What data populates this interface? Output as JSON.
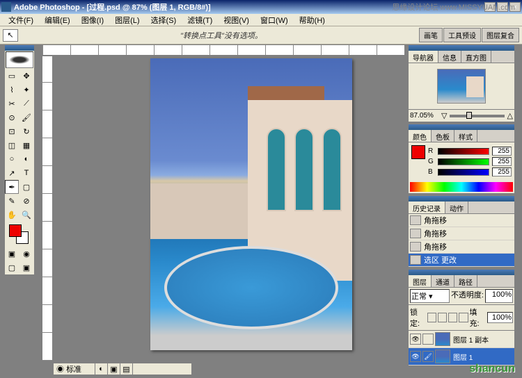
{
  "app": {
    "title": "Adobe Photoshop - [过程.psd @ 87% (图层 1, RGB/8#)]"
  },
  "menu": {
    "items": [
      "文件(F)",
      "编辑(E)",
      "图像(I)",
      "图层(L)",
      "选择(S)",
      "滤镜(T)",
      "视图(V)",
      "窗口(W)",
      "帮助(H)"
    ]
  },
  "options": {
    "message": "\"转换点工具\"没有选项。",
    "tabs": [
      "画笔",
      "工具预设",
      "图层复合"
    ]
  },
  "navigator": {
    "tabs": [
      "导航器",
      "信息",
      "直方图"
    ],
    "zoom": "87.05%"
  },
  "color": {
    "tabs": [
      "颜色",
      "色板",
      "样式"
    ],
    "r": {
      "label": "R",
      "value": "255"
    },
    "g": {
      "label": "G",
      "value": "255"
    },
    "b": {
      "label": "B",
      "value": "255"
    },
    "fg": "#e00000",
    "bg": "#ffffff"
  },
  "history": {
    "tabs": [
      "历史记录",
      "动作"
    ],
    "items": [
      "角拖移",
      "角拖移",
      "角拖移",
      "选区 更改"
    ],
    "active": 3
  },
  "layers": {
    "tabs": [
      "图层",
      "通道",
      "路径"
    ],
    "blend_label": "正常",
    "opacity_label": "不透明度:",
    "opacity": "100%",
    "lock_label": "锁定:",
    "fill_label": "填充:",
    "fill": "100%",
    "items": [
      {
        "name": "图层 1 副本",
        "visible": true
      },
      {
        "name": "图层 1",
        "visible": true
      }
    ],
    "active": 1
  },
  "status": {
    "label": "标准"
  },
  "watermark": {
    "main": "shancun",
    "top": "思缘设计论坛 www.MISSYUAN.com"
  }
}
